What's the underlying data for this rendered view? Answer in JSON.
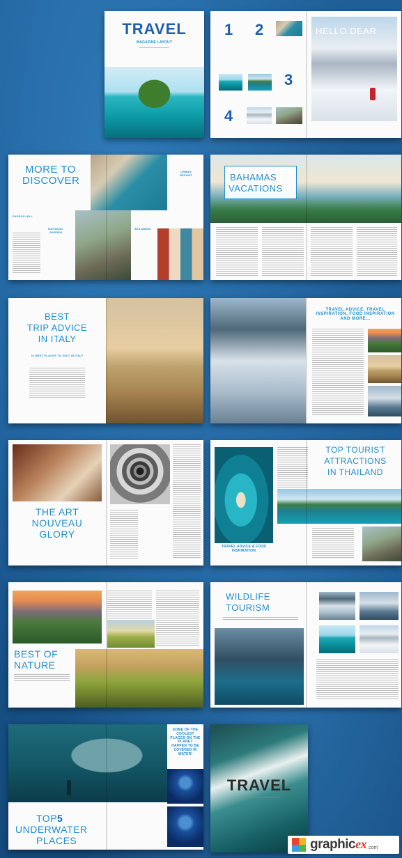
{
  "spreads": {
    "cover": {
      "title": "TRAVEL",
      "subtitle": "MAGAZINE LAYOUT"
    },
    "contents": {
      "numbers": [
        "1",
        "2",
        "3",
        "4"
      ],
      "hello_title": "HELLO DEAR"
    },
    "discover": {
      "title_line1": "MORE TO",
      "title_line2": "DISCOVER",
      "items": [
        "PAPPOO HILL",
        "NATIONAL GARDEN",
        "SEA MAGIC",
        "URBAN RESORT"
      ]
    },
    "bahamas": {
      "title_line1": "BAHAMAS",
      "title_line2": "VACATIONS"
    },
    "italy": {
      "title_line1": "BEST",
      "title_line2": "TRIP ADVICE",
      "title_line3": "IN ITALY",
      "subtitle": "10 BEST PLACES TO VISIT IN ITALY"
    },
    "advice": {
      "title": "TRAVEL ADVICE, TRAVEL INSPIRATION, FOOD INSPIRATION AND MORE..."
    },
    "nouveau": {
      "title_line1": "THE ART",
      "title_line2": "NOUVEAU",
      "title_line3": "GLORY"
    },
    "thailand": {
      "title_line1": "TOP TOURIST",
      "title_line2": "ATTRACTIONS",
      "title_line3": "IN THAILAND",
      "caption": "TRAVEL ADVICE & FOOD INSPIRATION"
    },
    "nature": {
      "title_line1": "BEST OF",
      "title_line2": "NATURE"
    },
    "wildlife": {
      "title_line1": "WILDLIFE",
      "title_line2": "TOURISM"
    },
    "underwater": {
      "title_line1": "TOP",
      "title_num": "5",
      "title_line2": "UNDERWATER",
      "title_line3": "PLACES",
      "callout": "SOME OF THE COOLEST PLACES ON THE PLANET HAPPEN TO BE COVERED IN WATER!"
    },
    "back": {
      "title": "TRAVEL"
    }
  },
  "watermark": {
    "brand": "graphic",
    "brand_ex": "ex",
    "domain": ".com"
  },
  "colors": {
    "background": "#1a5890",
    "heading_blue": "#1e8fd0",
    "dark_blue": "#1b5fae"
  }
}
